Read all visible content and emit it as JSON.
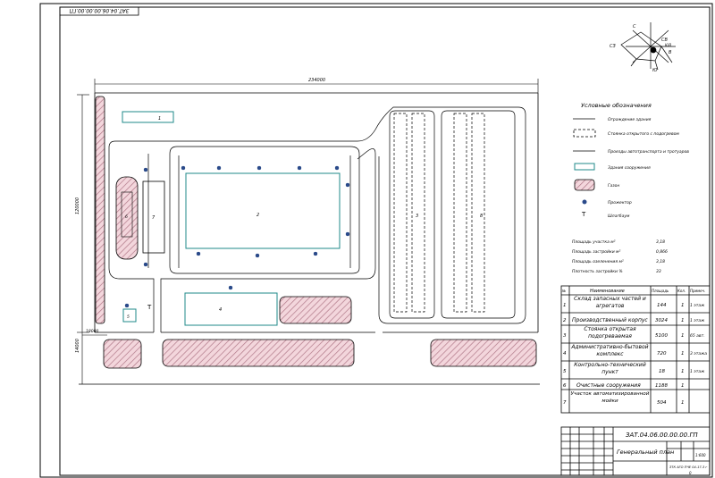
{
  "stamp_top": "ЗАТ.04.06.00.00.00.ГП",
  "dimensions": {
    "width": "234000",
    "height": "120000",
    "left_gap": "18000",
    "bottom_gap": "14000"
  },
  "north_rose": {
    "c": "С",
    "s": "Ю",
    "w": "СЗ",
    "e": "В",
    "nw": "З",
    "sw": "ЮЗ",
    "ne": "СВ",
    "se": "ЮВ"
  },
  "legend": {
    "title": "Условные обозначения",
    "items": [
      "Ограждение здания",
      "Стоянка открытого с подогревом",
      "Проезды автотранспорта и тротуаров",
      "Здания сооружения",
      "Газон",
      "Прожектор",
      "Шлагбаум"
    ]
  },
  "stats": [
    {
      "label": "Площадь участка м²",
      "value": "3,18"
    },
    {
      "label": "Площадь застройки м²",
      "value": "0,866"
    },
    {
      "label": "Площадь озеленения м²",
      "value": "3,18"
    },
    {
      "label": "Плотность застройки %",
      "value": "33"
    }
  ],
  "plan_labels": {
    "b1": "1",
    "b2": "2",
    "b3": "3",
    "b4": "4",
    "b5": "5",
    "b6": "6",
    "b7": "7",
    "b8": "8"
  },
  "table": {
    "headers": [
      "№",
      "Наименование",
      "Площадь",
      "Кол.",
      "Примеч."
    ],
    "rows": [
      {
        "n": "1",
        "name": "Склад запасных частей и агрегатов",
        "area": "144",
        "qty": "1",
        "note": "1 этаж"
      },
      {
        "n": "2",
        "name": "Производственный корпус",
        "area": "3024",
        "qty": "1",
        "note": "1 этаж"
      },
      {
        "n": "3",
        "name": "Стоянка открытая подогреваемая",
        "area": "5100",
        "qty": "1",
        "note": "65 авт."
      },
      {
        "n": "4",
        "name": "Административно-бытовой комплекс",
        "area": "720",
        "qty": "1",
        "note": "3 этажа"
      },
      {
        "n": "5",
        "name": "Контрольно-технический пункт",
        "area": "18",
        "qty": "1",
        "note": "1 этаж"
      },
      {
        "n": "6",
        "name": "Очистные сооружения",
        "area": "1188",
        "qty": "1",
        "note": ""
      },
      {
        "n": "7",
        "name": "Участок автоматизированной мойки",
        "area": "504",
        "qty": "1",
        "note": ""
      }
    ]
  },
  "title_block": {
    "code": "ЗАТ.04.06.00.00.00.ГП",
    "name": "Генеральный план",
    "sheet": "1:600",
    "org": "ЗТК АГО ПЧЕ 04-17-3 г",
    "bottom_num": "0"
  }
}
